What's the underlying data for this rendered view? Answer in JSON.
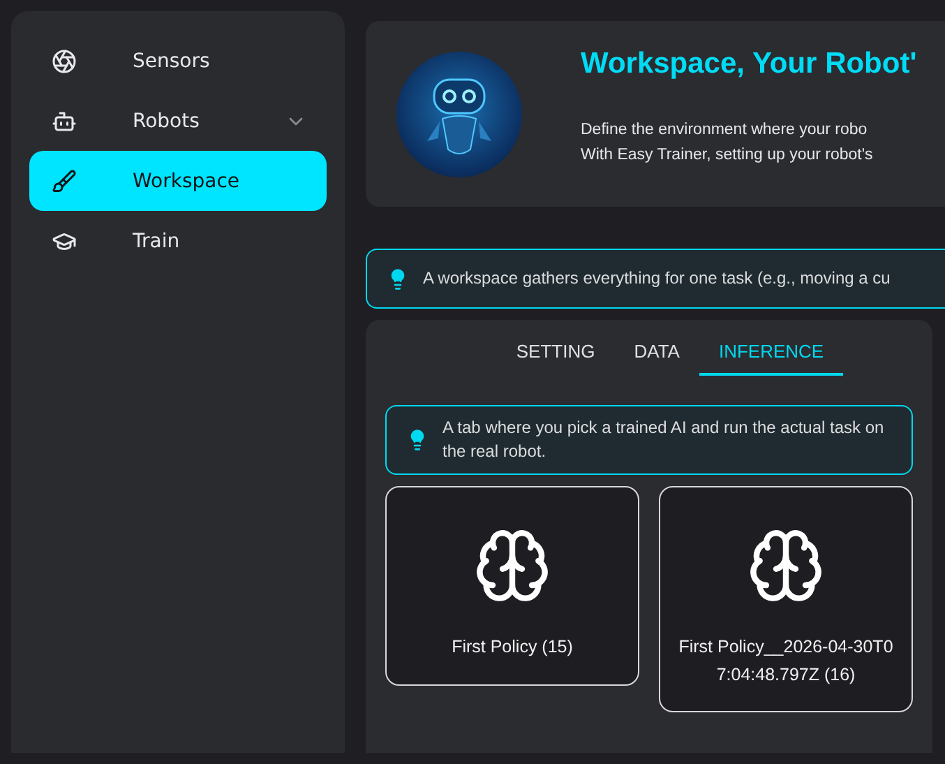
{
  "sidebar": {
    "items": [
      {
        "label": "Sensors",
        "kind": "link",
        "selected": false
      },
      {
        "label": "Robots",
        "kind": "group",
        "selected": false,
        "expanded": false
      },
      {
        "label": "Workspace",
        "kind": "link",
        "selected": true
      },
      {
        "label": "Train",
        "kind": "link",
        "selected": false
      }
    ]
  },
  "header": {
    "title": "Workspace, Your Robot'",
    "description": [
      "Define the environment where your robo",
      "With Easy Trainer, setting up your robot's"
    ]
  },
  "tip": "A workspace gathers everything for one task (e.g., moving a cu",
  "panel": {
    "tabs": [
      {
        "label": "SETTING",
        "selected": false
      },
      {
        "label": "DATA",
        "selected": false
      },
      {
        "label": "INFERENCE",
        "selected": true
      }
    ],
    "tip": "A tab where you pick a trained AI and run the actual task on the real robot.",
    "policies": [
      {
        "name": "First Policy (15)"
      },
      {
        "name": "First Policy__2026-04-30T07:04:48.797Z (16)"
      }
    ]
  }
}
